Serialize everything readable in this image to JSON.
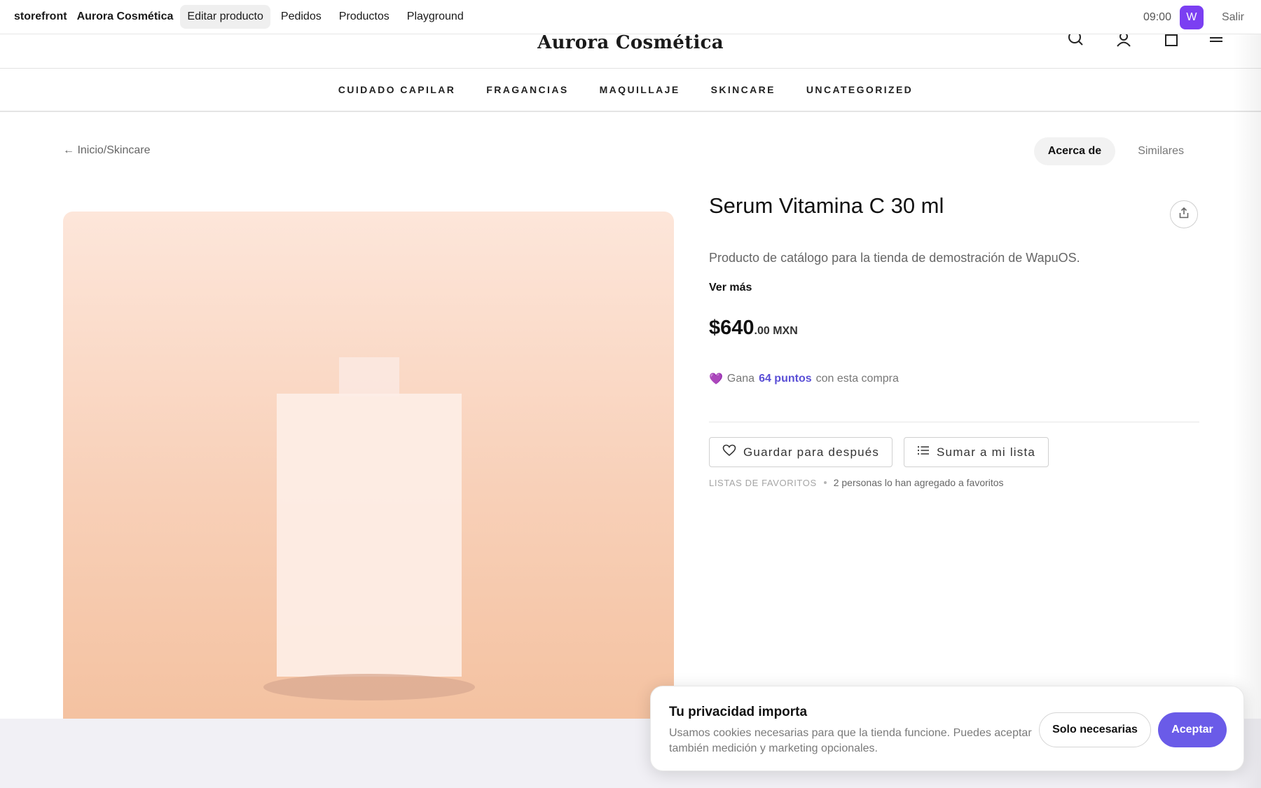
{
  "os_bar": {
    "app_name": "storefront",
    "store_name": "Aurora Cosmética",
    "menu": [
      "Editar producto",
      "Pedidos",
      "Productos",
      "Playground"
    ],
    "active_menu": "Editar producto",
    "time": "09:00",
    "avatar_letter": "W",
    "exit_label": "Salir",
    "avatar_color": "#7b3ff2"
  },
  "header": {
    "logo": "Aurora Cosmética",
    "icons": [
      "search-icon",
      "user-icon",
      "bag-icon",
      "menu-icon"
    ]
  },
  "categories": [
    "CUIDADO CAPILAR",
    "FRAGANCIAS",
    "MAQUILLAJE",
    "SKINCARE",
    "UNCATEGORIZED"
  ],
  "breadcrumb": {
    "back_arrow": "←",
    "path": "Inicio/Skincare"
  },
  "tabs": [
    {
      "label": "Acerca de",
      "active": true
    },
    {
      "label": "Similares",
      "active": false
    }
  ],
  "product": {
    "title": "Serum Vitamina C 30 ml",
    "description": "Producto de catálogo para la tienda de demostración de WapuOS.",
    "see_more": "Ver más",
    "price_main": "$640",
    "price_cents": ".00",
    "currency": "MXN",
    "points": {
      "emoji": "💜",
      "before": "Gana",
      "highlight": "64 puntos",
      "after": "con esta compra",
      "highlight_color": "#5a4fd6"
    },
    "save_button": "Guardar para después",
    "list_button": "Sumar a mi lista",
    "favorites_label": "LISTAS DE FAVORITOS",
    "favorites_count_text": "2 personas lo han agregado a favoritos"
  },
  "cookie_banner": {
    "title": "Tu privacidad importa",
    "text": "Usamos cookies necesarias para que la tienda funcione. Puedes aceptar también medición y marketing opcionales.",
    "secondary_button": "Solo necesarias",
    "primary_button": "Aceptar",
    "accent_color": "#6a5be8"
  }
}
